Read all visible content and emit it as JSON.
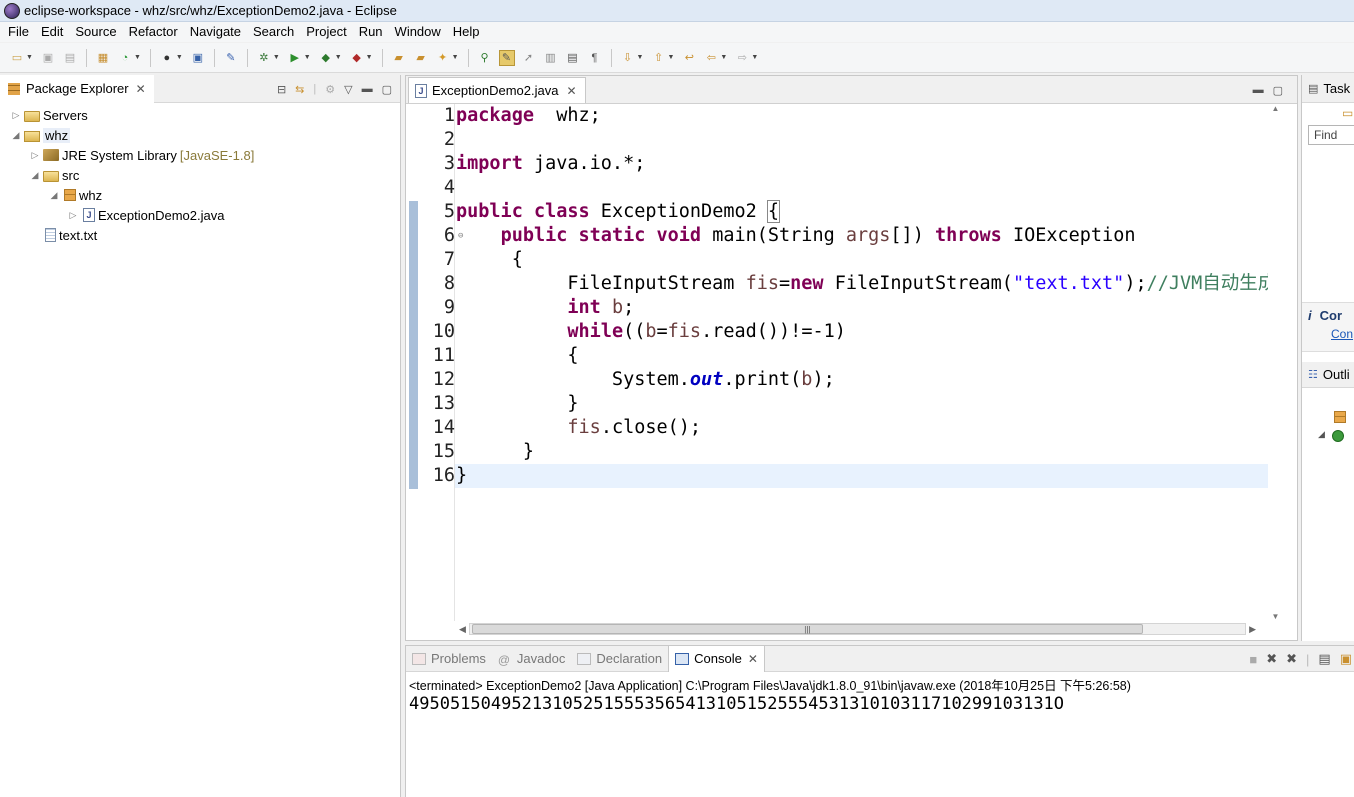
{
  "window": {
    "title": "eclipse-workspace - whz/src/whz/ExceptionDemo2.java - Eclipse"
  },
  "menu": [
    "File",
    "Edit",
    "Source",
    "Refactor",
    "Navigate",
    "Search",
    "Project",
    "Run",
    "Window",
    "Help"
  ],
  "package_explorer": {
    "title": "Package Explorer",
    "tree": [
      {
        "label": "Servers",
        "indent": 0,
        "twisty": "▷",
        "icon": "folder"
      },
      {
        "label": "whz",
        "indent": 0,
        "twisty": "◢",
        "icon": "project",
        "selected": true
      },
      {
        "label": "JRE System Library",
        "suffix": "[JavaSE-1.8]",
        "indent": 1,
        "twisty": "▷",
        "icon": "library"
      },
      {
        "label": "src",
        "indent": 1,
        "twisty": "◢",
        "icon": "folder"
      },
      {
        "label": "whz",
        "indent": 2,
        "twisty": "◢",
        "icon": "package"
      },
      {
        "label": "ExceptionDemo2.java",
        "indent": 3,
        "twisty": "▷",
        "icon": "java-file"
      },
      {
        "label": "text.txt",
        "indent": 1,
        "twisty": "",
        "icon": "text-file"
      }
    ]
  },
  "editor": {
    "tab_label": "ExceptionDemo2.java",
    "line_numbers": [
      "1",
      "2",
      "3",
      "4",
      "5",
      "6",
      "7",
      "8",
      "9",
      "10",
      "11",
      "12",
      "13",
      "14",
      "15",
      "16"
    ]
  },
  "right_panel": {
    "task_label": "Task",
    "find_placeholder": "Find",
    "connect_title": "Cor",
    "connect_link": "Con",
    "outline_label": "Outli"
  },
  "console": {
    "tabs": [
      {
        "label": "Problems",
        "active": false
      },
      {
        "label": "Javadoc",
        "active": false
      },
      {
        "label": "Declaration",
        "active": false
      },
      {
        "label": "Console",
        "active": true
      }
    ],
    "status": "<terminated> ExceptionDemo2 [Java Application] C:\\Program Files\\Java\\jdk1.8.0_91\\bin\\javaw.exe (2018年10月25日 下午5:26:58)",
    "output": "495051504952131052515553565413105152555453131010311710299103131O"
  },
  "colors": {
    "keyword": "#7f0055",
    "string": "#2a00ff",
    "comment": "#3f7f5f",
    "static_field": "#0000c0",
    "current_line": "#e8f2fe"
  }
}
